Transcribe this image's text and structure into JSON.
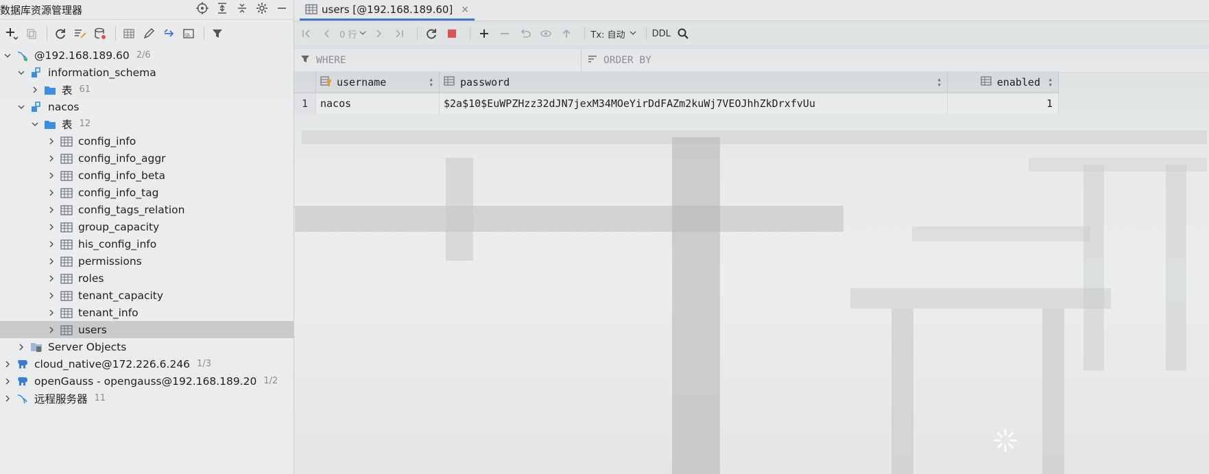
{
  "explorer": {
    "title": "数据库资源管理器",
    "tree": [
      {
        "label": "@192.168.189.60",
        "count": "2/6"
      },
      {
        "label": "information_schema",
        "count": ""
      },
      {
        "label": "表",
        "count": "61"
      },
      {
        "label": "nacos",
        "count": ""
      },
      {
        "label": "表",
        "count": "12"
      },
      {
        "label": "config_info",
        "count": ""
      },
      {
        "label": "config_info_aggr",
        "count": ""
      },
      {
        "label": "config_info_beta",
        "count": ""
      },
      {
        "label": "config_info_tag",
        "count": ""
      },
      {
        "label": "config_tags_relation",
        "count": ""
      },
      {
        "label": "group_capacity",
        "count": ""
      },
      {
        "label": "his_config_info",
        "count": ""
      },
      {
        "label": "permissions",
        "count": ""
      },
      {
        "label": "roles",
        "count": ""
      },
      {
        "label": "tenant_capacity",
        "count": ""
      },
      {
        "label": "tenant_info",
        "count": ""
      },
      {
        "label": "users",
        "count": ""
      },
      {
        "label": "Server Objects",
        "count": ""
      },
      {
        "label": "cloud_native@172.226.6.246",
        "count": "1/3"
      },
      {
        "label": "openGauss - opengauss@192.168.189.20",
        "count": "1/2"
      },
      {
        "label": "远程服务器",
        "count": "11"
      }
    ]
  },
  "editor": {
    "tab_title": "users [@192.168.189.60]",
    "tab_close": "×",
    "rows_label": "0 行",
    "tx_label": "Tx: 自动",
    "ddl_label": "DDL",
    "where_label": "WHERE",
    "orderby_label": "ORDER BY",
    "columns": [
      "username",
      "password",
      "enabled"
    ],
    "rows": [
      {
        "num": "1",
        "username": "nacos",
        "password": "$2a$10$EuWPZHzz32dJN7jexM34MOeYirDdFAZm2kuWj7VEOJhhZkDrxfvUu",
        "enabled": "1"
      }
    ]
  },
  "colors": {
    "accent": "#3c74d8",
    "folder": "#3d8ee0",
    "schema": "#3d8ee0",
    "stop": "#e05252"
  }
}
